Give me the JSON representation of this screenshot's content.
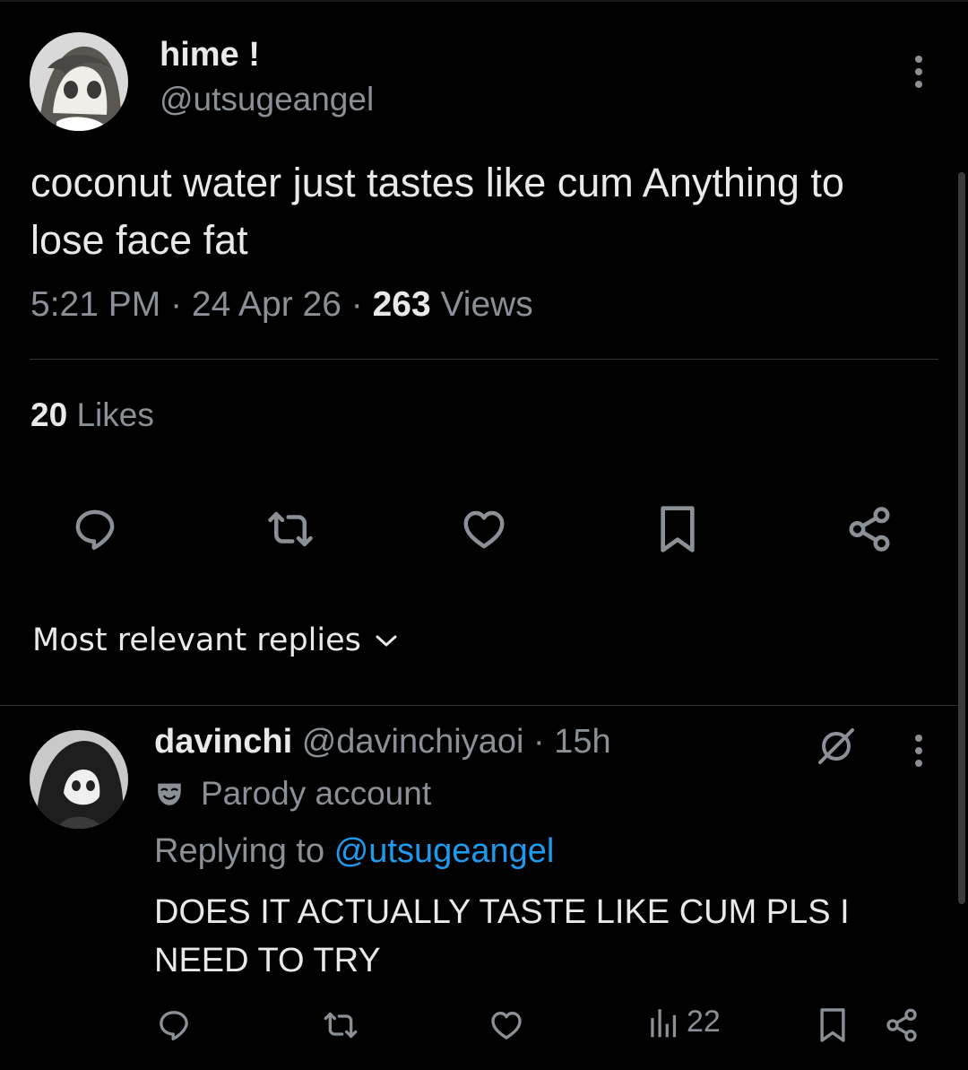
{
  "tweet": {
    "author_name": "hime !",
    "author_handle": "@utsugeangel",
    "text": "coconut water just tastes like cum Anything to lose face fat",
    "time": "5:21 PM",
    "date": "24 Apr 26",
    "views_count": "263",
    "views_label": "Views",
    "likes_count": "20",
    "likes_label": "Likes"
  },
  "replies_sort": {
    "label": "Most relevant replies"
  },
  "reply": {
    "author_name": "davinchi",
    "author_handle": "@davinchiyaoi",
    "age": "15h",
    "parody_label": "Parody account",
    "replying_prefix": "Replying to",
    "replying_handle": "@utsugeangel",
    "text": "DOES IT ACTUALLY TASTE LIKE CUM PLS I NEED TO TRY",
    "views": "22"
  },
  "icons": {
    "reply": "reply-icon",
    "retweet": "retweet-icon",
    "like": "heart-icon",
    "bookmark": "bookmark-icon",
    "share": "share-icon",
    "views": "views-icon",
    "grok": "grok-icon",
    "parody": "parody-mask-icon",
    "more": "more-icon",
    "chevron": "chevron-down-icon"
  },
  "colors": {
    "background": "#000000",
    "text_primary": "#e7e9ea",
    "text_secondary": "#8b9096",
    "link": "#1d9bf0",
    "divider": "#2f3336"
  }
}
